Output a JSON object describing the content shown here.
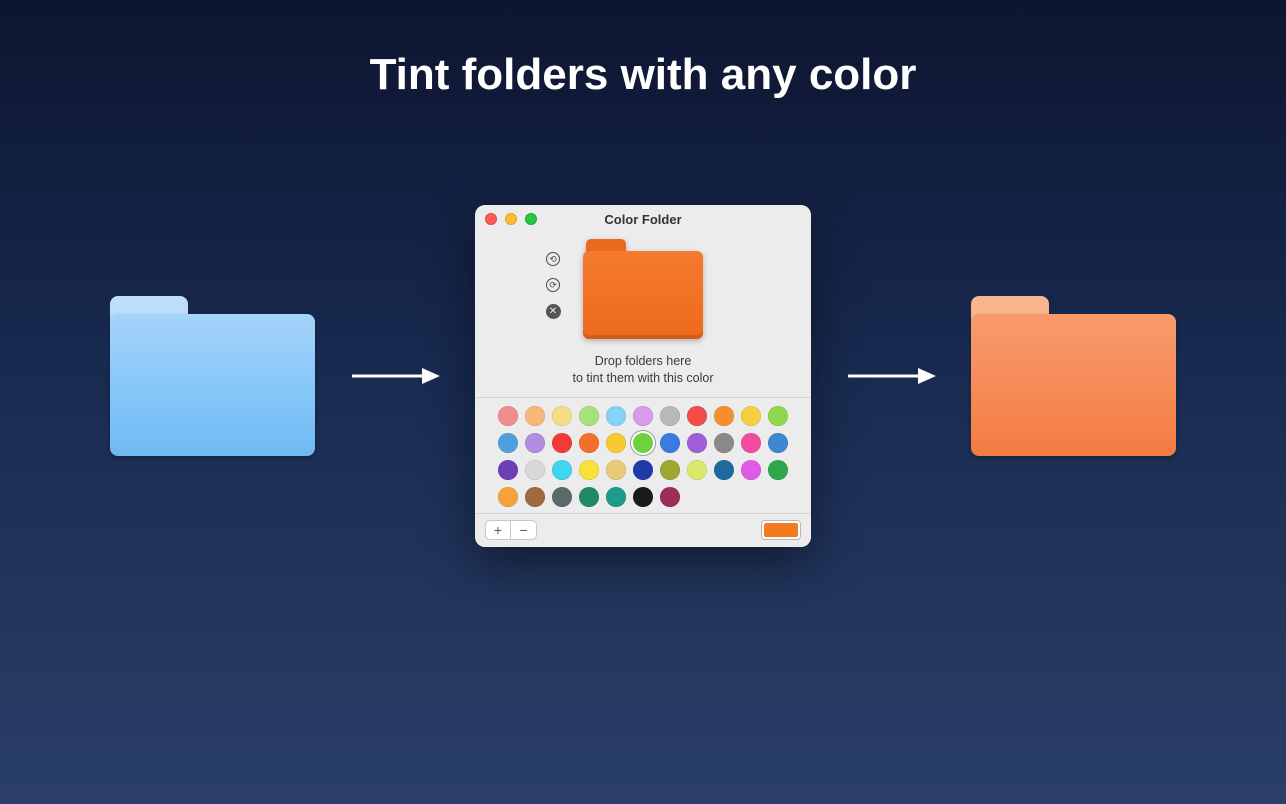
{
  "page_title": "Tint folders with any color",
  "app": {
    "window_title": "Color Folder",
    "hint_line1": "Drop folders here",
    "hint_line2": "to tint them with this color",
    "preview_color": "#ee6a1c",
    "selected_swatch_index": 16,
    "color_well": "#f47a1e",
    "swatches": [
      "#ee8d8a",
      "#f4b77c",
      "#f4de83",
      "#a8e07c",
      "#88d3f5",
      "#d89be9",
      "#b8b8b8",
      "#f34b47",
      "#f58f2e",
      "#f5cf3e",
      "#8fd94a",
      "#4ea0e0",
      "#b38de0",
      "#f33a36",
      "#f56f2a",
      "#f5c92f",
      "#6fd23d",
      "#3a7be0",
      "#a05ed6",
      "#8a8a8a",
      "#f34ba0",
      "#3b87d0",
      "#6f3fb8",
      "#d8d8d8",
      "#3ed6f0",
      "#f5e23a",
      "#e8c977",
      "#1e3aa8",
      "#9ea82e",
      "#d8e86a",
      "#1e6aa0",
      "#e05ae8",
      "#2fa84a",
      "#f5a23a",
      "#a06a3f",
      "#5a6a6a",
      "#1e8a6a",
      "#1e9a8a",
      "#1a1a1a",
      "#a02a5a"
    ]
  },
  "folders": {
    "left_color": "blue",
    "right_color": "orange"
  }
}
